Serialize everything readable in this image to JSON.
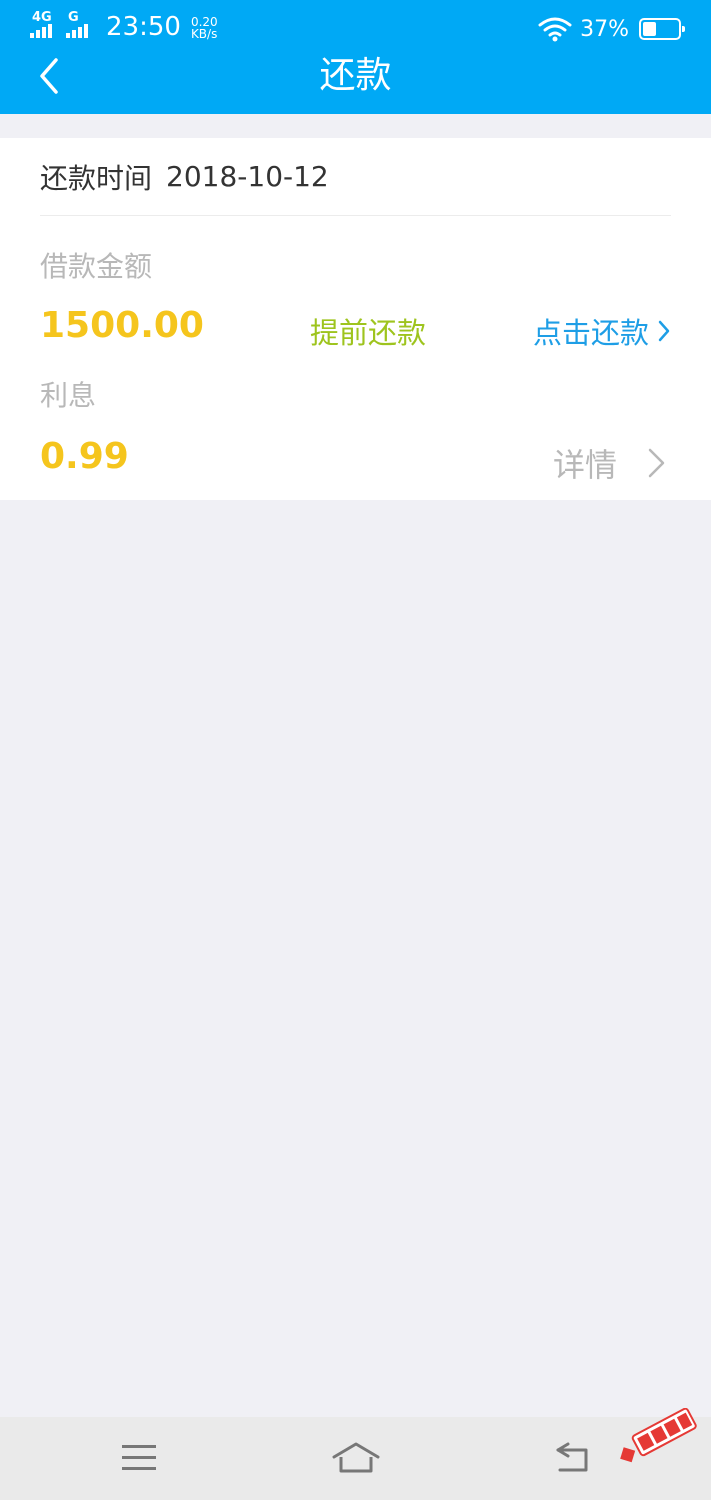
{
  "status": {
    "network1": "4G",
    "network2": "G",
    "time": "23:50",
    "speed_value": "0.20",
    "speed_unit": "KB/s",
    "battery": "37%",
    "battery_level": 0.37
  },
  "nav": {
    "title": "还款",
    "back_icon": "chevron-left-icon"
  },
  "repayment": {
    "date_label": "还款时间",
    "date_value": "2018-10-12",
    "loan_label": "借款金额",
    "loan_amount": "1500.00",
    "early_repay_label": "提前还款",
    "click_repay_label": "点击还款",
    "interest_label": "利息",
    "interest_amount": "0.99",
    "detail_label": "详情"
  },
  "colors": {
    "header": "#00a9f5",
    "amount": "#f5c51d",
    "early_repay": "#9ec41e",
    "click_repay": "#1e9ee6",
    "muted": "#b8b8b8"
  },
  "system_nav": {
    "menu_icon": "menu-icon",
    "home_icon": "home-icon",
    "back_icon": "back-icon"
  }
}
